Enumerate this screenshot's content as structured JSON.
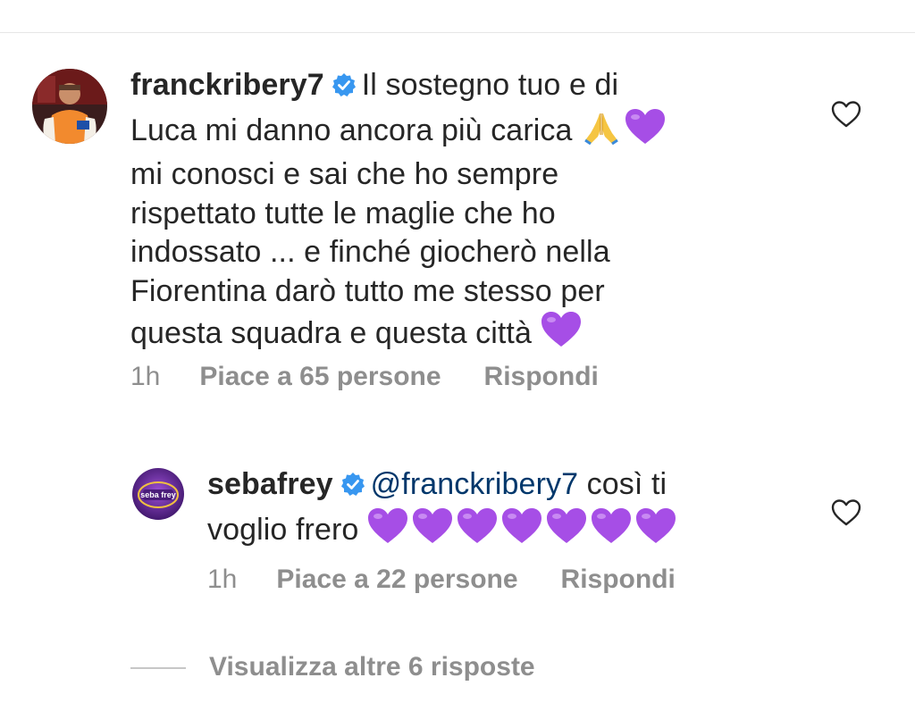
{
  "comments": [
    {
      "username": "franckribery7",
      "lines": [
        "Il sostegno tuo e di",
        "Luca mi danno ancora più carica",
        "mi conosci e sai che ho sempre",
        "rispettato tutte le maglie che ho",
        "indossato ... e finché giocherò nella",
        "Fiorentina darò tutto me stesso per",
        "questa squadra e questa città"
      ],
      "time": "1h",
      "likes": "Piace a 65 persone",
      "reply": "Rispondi",
      "verified": true,
      "emojis": [
        "pray-emoji",
        "purple-heart-emoji",
        "purple-heart-emoji"
      ]
    }
  ],
  "reply": {
    "username": "sebafrey",
    "mention": "@franckribery7",
    "text_after_mention": "così ti",
    "line2": "voglio frero",
    "heart_count": 7,
    "time": "1h",
    "likes": "Piace a 22 persone",
    "reply": "Rispondi",
    "verified": true,
    "avatar_text": "seba frey"
  },
  "view_more": "Visualizza altre 6 risposte",
  "colors": {
    "text": "#262626",
    "secondary": "#8e8e8e",
    "mention": "#00376b",
    "verified": "#3897f0",
    "heart": "#a64ee6"
  }
}
